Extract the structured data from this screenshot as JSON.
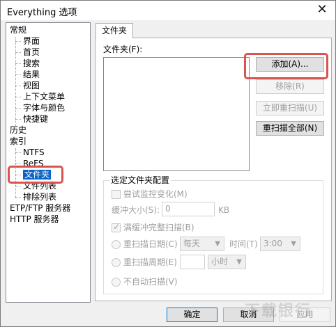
{
  "window": {
    "title": "Everything 选项"
  },
  "tree": {
    "items": [
      "常规",
      "界面",
      "首页",
      "搜索",
      "结果",
      "视图",
      "上下文菜单",
      "字体与颜色",
      "快捷键",
      "历史",
      "索引",
      "NTFS",
      "ReFS",
      "文件夹",
      "文件列表",
      "排除列表",
      "ETP/FTP 服务器",
      "HTTP 服务器"
    ]
  },
  "tab": {
    "label": "文件夹"
  },
  "folders": {
    "label": "文件夹(F):",
    "add": "添加(A)...",
    "remove": "移除(R)",
    "rescan_now": "立即重扫描(U)",
    "rescan_all": "重扫描全部(N)"
  },
  "config": {
    "title": "选定文件夹配置",
    "monitor": "尝试监控变化(M)",
    "buffer_label": "缓冲大小(S):",
    "buffer_value": "0",
    "buffer_unit": "KB",
    "rescan_on_full": "满缓冲完整扫描(B)",
    "rescan_day": "重扫描日期(C)",
    "day_value": "每天",
    "time_label": "时间(T)",
    "time_value": "3:00",
    "rescan_every": "重扫描周期(E)",
    "period_value": "",
    "period_unit": "小时",
    "no_auto": "不自动扫描(V)"
  },
  "buttons": {
    "ok": "确定",
    "cancel": "取消",
    "apply": "应用"
  },
  "watermark": "下载银行"
}
